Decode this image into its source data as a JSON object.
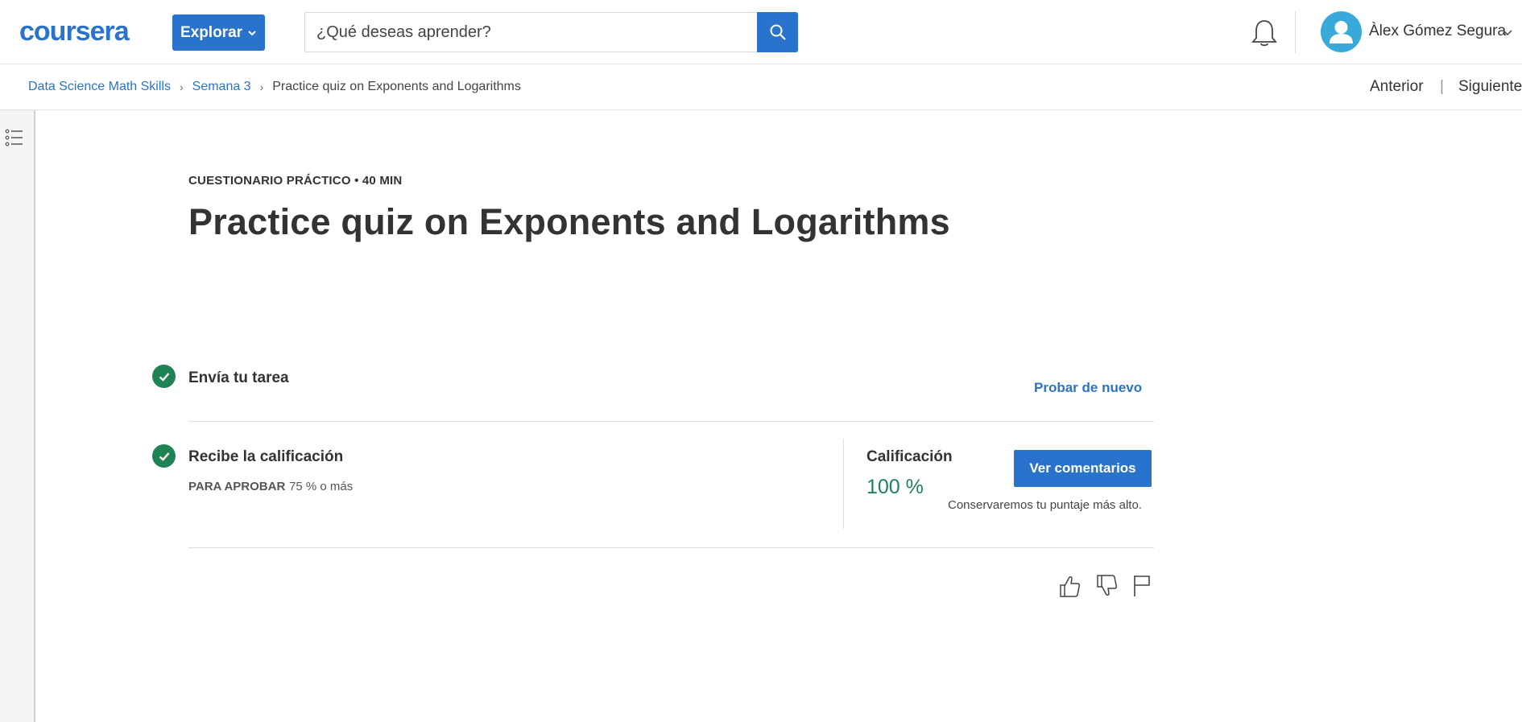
{
  "header": {
    "logo_text": "coursera",
    "explore_label": "Explorar",
    "search_placeholder": "¿Qué deseas aprender?",
    "user_name": "Àlex Gómez Segura",
    "brand_color": "#2a73cc"
  },
  "breadcrumb": {
    "items": [
      "Data Science Math Skills",
      "Semana 3"
    ],
    "current": "Practice quiz on Exponents and Logarithms"
  },
  "nav": {
    "prev": "Anterior",
    "separator": "|",
    "next": "Siguiente"
  },
  "content": {
    "eyebrow": "CUESTIONARIO PRÁCTICO • 40 MIN",
    "title": "Practice quiz on Exponents and Logarithms"
  },
  "steps": {
    "submit": {
      "label": "Envía tu tarea",
      "action": "Probar de nuevo"
    },
    "grade": {
      "label": "Recibe la calificación",
      "pass_label": "PARA APROBAR",
      "pass_value": "75 % o más",
      "grade_label": "Calificación",
      "grade_value": "100 %",
      "feedback_button": "Ver comentarios",
      "note": "Conservaremos tu puntaje más alto.",
      "success_color": "#1f8354"
    }
  },
  "icons": {
    "search": "search-icon",
    "bell": "bell-icon",
    "avatar": "user-avatar-icon",
    "outline": "course-outline-icon",
    "like": "thumbs-up-icon",
    "dislike": "thumbs-down-icon",
    "flag": "flag-icon"
  }
}
